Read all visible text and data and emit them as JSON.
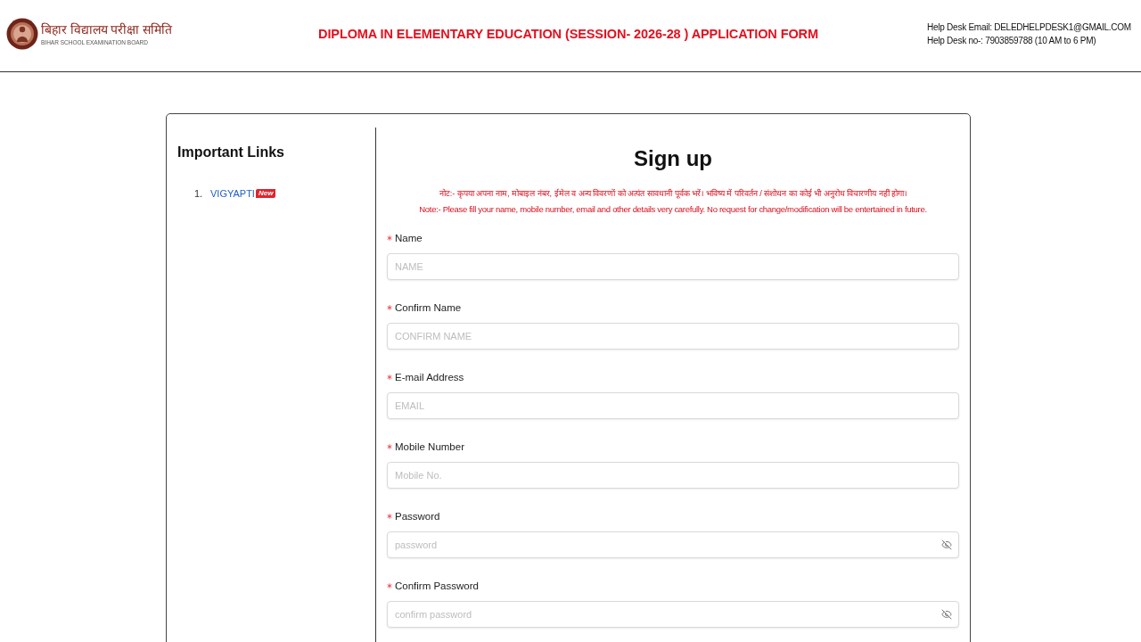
{
  "header": {
    "board_name_hindi": "बिहार विद्यालय परीक्षा समिति",
    "board_name_english": "BIHAR SCHOOL EXAMINATION BOARD",
    "title": "DIPLOMA IN ELEMENTARY EDUCATION (SESSION- 2026-28 ) APPLICATION FORM",
    "help_desk": [
      "Help Desk Email: DELEDHELPDESK1@GMAIL.COM",
      "Help Desk no-: 7903859788 (10 AM to 6 PM)"
    ]
  },
  "sidebar": {
    "heading": "Important Links",
    "links": [
      {
        "number": "1.",
        "label": "VIGYAPTI",
        "badge": "New"
      }
    ]
  },
  "form": {
    "title": "Sign up",
    "notes": [
      "नोट:- कृपया अपना नाम, मोबाइल नंबर, ईमेल व अन्य विवरणों को अत्यंत सावधानी पूर्वक भरें। भविष्य में परिवर्तन / संशोधन का कोई भी अनुरोध विचारणीय नहीं होगा।",
      "Note:- Please fill your name, mobile number, email and other details very carefully. No request for change/modification will be entertained in future."
    ],
    "fields": [
      {
        "kind": "text",
        "label": "Name",
        "placeholder": "NAME",
        "required": true
      },
      {
        "kind": "text",
        "label": "Confirm Name",
        "placeholder": "CONFIRM NAME",
        "required": true
      },
      {
        "kind": "text",
        "label": "E-mail Address",
        "placeholder": "EMAIL",
        "required": true
      },
      {
        "kind": "text",
        "label": "Mobile Number",
        "placeholder": "Mobile No.",
        "required": true
      },
      {
        "kind": "password",
        "label": "Password",
        "placeholder": "password",
        "required": true
      },
      {
        "kind": "password",
        "label": "Confirm Password",
        "placeholder": "confirm password",
        "required": true
      }
    ]
  }
}
